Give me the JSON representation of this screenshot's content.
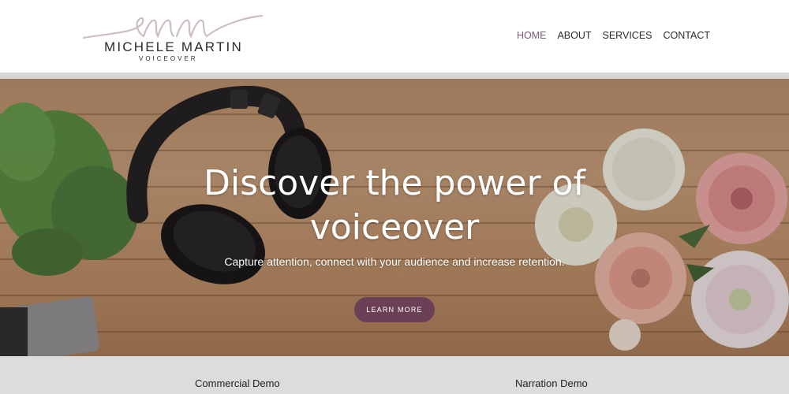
{
  "logo": {
    "name": "MICHELE MARTIN",
    "tagline": "VOICEOVER"
  },
  "nav": {
    "items": [
      "HOME",
      "ABOUT",
      "SERVICES",
      "CONTACT"
    ],
    "active": "HOME"
  },
  "hero": {
    "title": "Discover the power of voiceover",
    "subtitle": "Capture attention, connect with your audience and increase retention.",
    "cta_label": "LEARN MORE"
  },
  "demos": {
    "items": [
      "Commercial Demo",
      "Narration Demo"
    ]
  },
  "colors": {
    "accent": "#6b3f56",
    "nav_active": "#7d5a72",
    "demo_bg": "#dcdcdc",
    "logo_script": "#cdbfbf"
  }
}
